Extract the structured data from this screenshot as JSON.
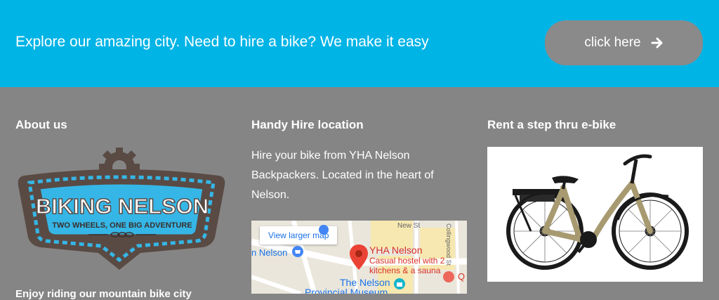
{
  "banner": {
    "text": "Explore our amazing city. Need to hire a bike? We make it easy",
    "button_label": "click here"
  },
  "footer": {
    "about": {
      "title": "About us",
      "logo_main": "BIKING NELSON",
      "logo_tagline": "TWO WHEELS, ONE BIG ADVENTURE",
      "cut_text": "Enjoy riding our mountain bike city"
    },
    "location": {
      "title": "Handy Hire location",
      "description": "Hire your bike from YHA Nelson Backpackers. Located in the heart of Nelson.",
      "map": {
        "link_label": "View larger map",
        "place_name": "YHA Nelson",
        "place_desc_1": "Casual hostel with 2",
        "place_desc_2": "kitchens & a sauna",
        "street_1": "New St",
        "street_2": "Collingwood St",
        "poi_1": "The Nelson",
        "poi_2": "Provincial Museum",
        "poi_left": "n Nelson",
        "poi_right": "Q"
      }
    },
    "ebike": {
      "title": "Rent a step thru e-bike"
    }
  },
  "colors": {
    "banner_bg": "#00b4e6",
    "footer_bg": "#858585",
    "button_bg": "#8a8a8a",
    "logo_blue": "#35b6e6",
    "logo_brown": "#5a4a44"
  }
}
